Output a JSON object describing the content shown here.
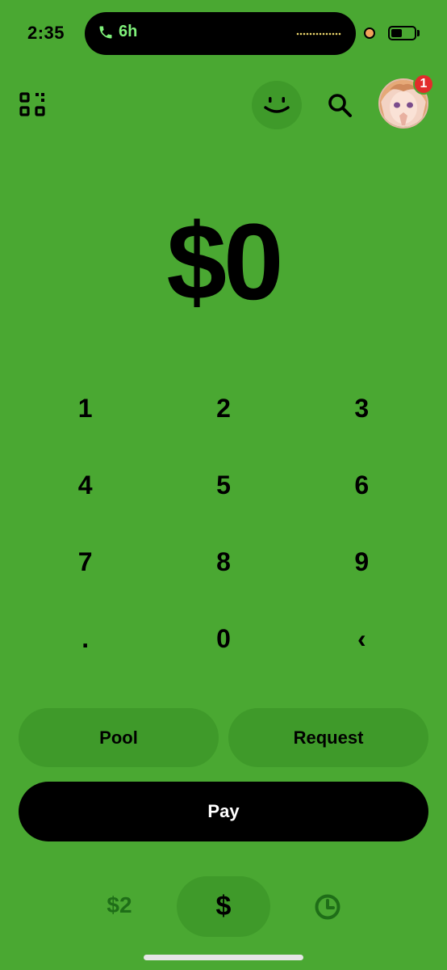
{
  "status_bar": {
    "time": "2:35",
    "call_duration": "6h"
  },
  "header": {
    "notification_count": "1"
  },
  "amount": {
    "display": "$0"
  },
  "keypad": {
    "keys": [
      "1",
      "2",
      "3",
      "4",
      "5",
      "6",
      "7",
      "8",
      "9",
      ".",
      "0",
      "‹"
    ]
  },
  "actions": {
    "pool_label": "Pool",
    "request_label": "Request",
    "pay_label": "Pay"
  },
  "bottom_nav": {
    "balance_label": "$2",
    "cash_label": "$"
  },
  "colors": {
    "background": "#4aa832",
    "button_fill": "#3f9a2a",
    "pay_button": "#000000",
    "badge": "#e22b2b"
  },
  "icons": [
    "phone-icon",
    "scan-icon",
    "smiley-icon",
    "search-icon",
    "avatar",
    "clock-icon"
  ]
}
